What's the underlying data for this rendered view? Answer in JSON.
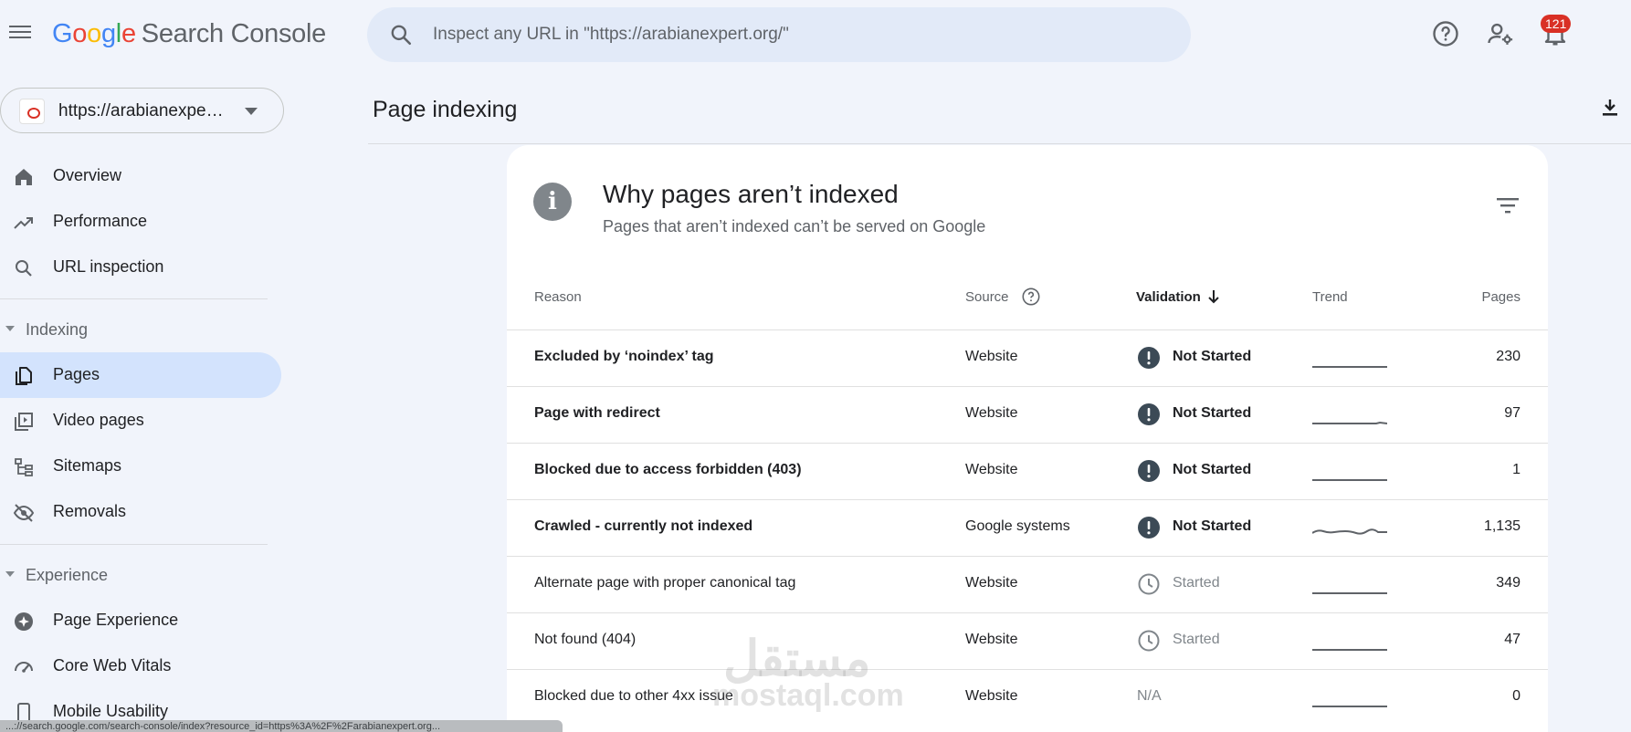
{
  "app": {
    "logo_letters": [
      "G",
      "o",
      "o",
      "g",
      "l",
      "e"
    ],
    "logo_product": "Search Console"
  },
  "search": {
    "placeholder": "Inspect any URL in \"https://arabianexpert.org/\""
  },
  "top_icons": [
    "help-icon",
    "user-settings-icon",
    "notifications-icon"
  ],
  "notifications": {
    "count": "121"
  },
  "property": {
    "label": "https://arabianexpert.org/"
  },
  "sidebar": {
    "items": [
      {
        "label": "Overview",
        "icon": "home-icon"
      },
      {
        "label": "Performance",
        "icon": "trending-up-icon"
      },
      {
        "label": "URL inspection",
        "icon": "search-icon"
      }
    ],
    "indexing": {
      "header": "Indexing",
      "items": [
        {
          "label": "Pages",
          "icon": "pages-icon",
          "active": true
        },
        {
          "label": "Video pages",
          "icon": "video-pages-icon"
        },
        {
          "label": "Sitemaps",
          "icon": "sitemap-icon"
        },
        {
          "label": "Removals",
          "icon": "visibility-off-icon"
        }
      ]
    },
    "experience": {
      "header": "Experience",
      "items": [
        {
          "label": "Page Experience",
          "icon": "page-experience-icon"
        },
        {
          "label": "Core Web Vitals",
          "icon": "speedometer-icon"
        },
        {
          "label": "Mobile Usability",
          "icon": "mobile-icon"
        }
      ]
    }
  },
  "page": {
    "title": "Page indexing"
  },
  "card": {
    "title": "Why pages aren’t indexed",
    "subtitle": "Pages that aren’t indexed can’t be served on Google",
    "columns": {
      "reason": "Reason",
      "source": "Source",
      "validation": "Validation",
      "trend": "Trend",
      "pages": "Pages"
    },
    "rows": [
      {
        "reason": "Excluded by ‘noindex’ tag",
        "source": "Website",
        "validation": "Not Started",
        "pages": "230",
        "status": "not-started",
        "bold": true
      },
      {
        "reason": "Page with redirect",
        "source": "Website",
        "validation": "Not Started",
        "pages": "97",
        "status": "not-started",
        "bold": true
      },
      {
        "reason": "Blocked due to access forbidden (403)",
        "source": "Website",
        "validation": "Not Started",
        "pages": "1",
        "status": "not-started",
        "bold": true
      },
      {
        "reason": "Crawled - currently not indexed",
        "source": "Google systems",
        "validation": "Not Started",
        "pages": "1,135",
        "status": "not-started",
        "bold": true
      },
      {
        "reason": "Alternate page with proper canonical tag",
        "source": "Website",
        "validation": "Started",
        "pages": "349",
        "status": "started",
        "bold": false
      },
      {
        "reason": "Not found (404)",
        "source": "Website",
        "validation": "Started",
        "pages": "47",
        "status": "started",
        "bold": false
      },
      {
        "reason": "Blocked due to other 4xx issue",
        "source": "Website",
        "validation": "N/A",
        "pages": "0",
        "status": "na",
        "bold": false
      }
    ]
  },
  "watermark": {
    "arabic": "مستقل",
    "latin": "mostaql.com"
  },
  "status_bar": {
    "url": "...://search.google.com/search-console/index?resource_id=https%3A%2F%2Farabianexpert.org..."
  },
  "colors": {
    "accent": "#d3e3fd",
    "badge": "#d93025",
    "status_dark": "#3c4a56"
  }
}
